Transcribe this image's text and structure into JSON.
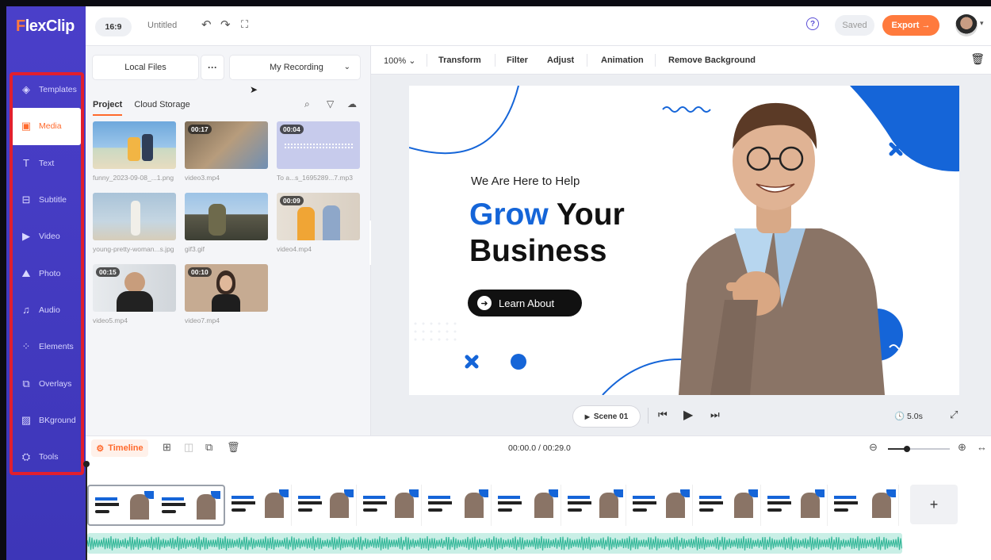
{
  "app": {
    "logo_letter": "F",
    "logo_rest": "lexClip"
  },
  "sidebar": {
    "items": [
      {
        "label": "Templates",
        "icon": "layers-icon",
        "glyph": "◈"
      },
      {
        "label": "Media",
        "icon": "media-icon",
        "glyph": "▣"
      },
      {
        "label": "Text",
        "icon": "text-icon",
        "glyph": "T"
      },
      {
        "label": "Subtitle",
        "icon": "subtitle-icon",
        "glyph": "⊟"
      },
      {
        "label": "Video",
        "icon": "video-icon",
        "glyph": "▶"
      },
      {
        "label": "Photo",
        "icon": "photo-icon",
        "glyph": "⛰"
      },
      {
        "label": "Audio",
        "icon": "audio-icon",
        "glyph": "♫"
      },
      {
        "label": "Elements",
        "icon": "elements-icon",
        "glyph": "⁘"
      },
      {
        "label": "Overlays",
        "icon": "overlays-icon",
        "glyph": "⧉"
      },
      {
        "label": "BKground",
        "icon": "background-icon",
        "glyph": "▨"
      },
      {
        "label": "Tools",
        "icon": "tools-icon",
        "glyph": "⛭"
      }
    ],
    "active_index": 1,
    "highlight_color": "#e11f2e"
  },
  "topbar": {
    "ratio": "16:9",
    "title": "Untitled",
    "help": "?",
    "saved": "Saved",
    "export": "Export →",
    "export_color": "#ff7a3d"
  },
  "media": {
    "local_files": "Local Files",
    "more": "···",
    "source": "My Recording",
    "tabs": [
      "Project",
      "Cloud Storage"
    ],
    "items": [
      {
        "name": "funny_2023-09-08_...1.png",
        "duration": ""
      },
      {
        "name": "video3.mp4",
        "duration": "00:17"
      },
      {
        "name": "To a...s_1695289...7.mp3",
        "duration": "00:04"
      },
      {
        "name": "young-pretty-woman...s.jpg",
        "duration": ""
      },
      {
        "name": "gif3.gif",
        "duration": ""
      },
      {
        "name": "video4.mp4",
        "duration": "00:09"
      },
      {
        "name": "video5.mp4",
        "duration": "00:15"
      },
      {
        "name": "video7.mp4",
        "duration": "00:10"
      }
    ]
  },
  "canvas_toolbar": {
    "zoom": "100%",
    "items": [
      "Transform",
      "Filter",
      "Adjust",
      "Animation",
      "Remove Background"
    ]
  },
  "slide": {
    "kicker": "We Are Here to Help",
    "headline_accent": "Grow",
    "headline_rest": "Your",
    "headline_line2": "Business",
    "cta": "Learn About",
    "accent_color": "#1565d8"
  },
  "playback": {
    "scene": "Scene 01",
    "duration": "5.0s"
  },
  "timeline": {
    "label": "Timeline",
    "time": "00:00.0 / 00:29.0",
    "zoom_level": 0.3,
    "add_label": "+"
  }
}
